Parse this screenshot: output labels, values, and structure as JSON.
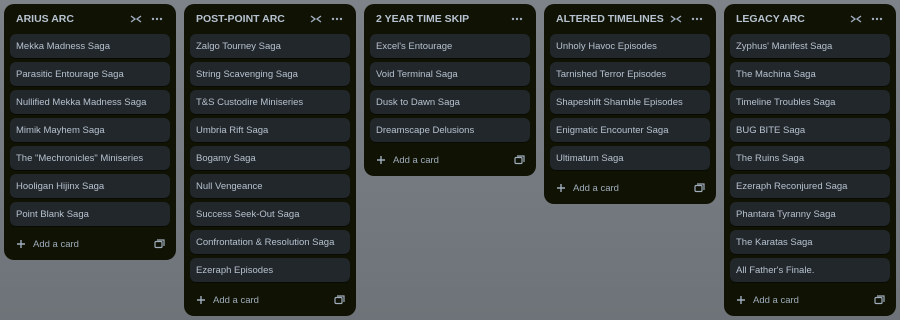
{
  "colors": {
    "board_background": "#737a80",
    "list_background": "#101204",
    "card_background": "#22272b",
    "text": "#b6c2cf"
  },
  "icons": {
    "collapse": "collapse-arrows-icon",
    "more": "ellipsis-icon",
    "add": "plus-icon",
    "template": "card-template-icon"
  },
  "lists": [
    {
      "title": "ARIUS ARC",
      "cards": [
        "Mekka Madness Saga",
        "Parasitic Entourage Saga",
        "Nullified Mekka Madness Saga",
        "Mimik Mayhem Saga",
        "The \"Mechronicles\" Miniseries",
        "Hooligan Hijinx Saga",
        "Point Blank Saga"
      ],
      "add_label": "Add a card"
    },
    {
      "title": "POST-POINT ARC",
      "cards": [
        "Zalgo Tourney Saga",
        "String Scavenging Saga",
        "T&S Custodire Miniseries",
        "Umbria Rift Saga",
        "Bogamy Saga",
        "Null Vengeance",
        "Success Seek-Out Saga",
        "Confrontation & Resolution Saga",
        "Ezeraph Episodes"
      ],
      "add_label": "Add a card"
    },
    {
      "title": "2 YEAR TIME SKIP",
      "cards": [
        "Excel's Entourage",
        "Void Terminal Saga",
        "Dusk to Dawn Saga",
        "Dreamscape Delusions"
      ],
      "add_label": "Add a card"
    },
    {
      "title": "ALTERED TIMELINES",
      "cards": [
        "Unholy Havoc Episodes",
        "Tarnished Terror Episodes",
        "Shapeshift Shamble Episodes",
        "Enigmatic Encounter Saga",
        "Ultimatum Saga"
      ],
      "add_label": "Add a card"
    },
    {
      "title": "LEGACY ARC",
      "cards": [
        "Zyphus' Manifest Saga",
        "The Machina Saga",
        "Timeline Troubles Saga",
        "BUG BITE Saga",
        "The Ruins Saga",
        "Ezeraph Reconjured Saga",
        "Phantara Tyranny Saga",
        "The Karatas Saga",
        "All Father's Finale."
      ],
      "add_label": "Add a card"
    }
  ]
}
